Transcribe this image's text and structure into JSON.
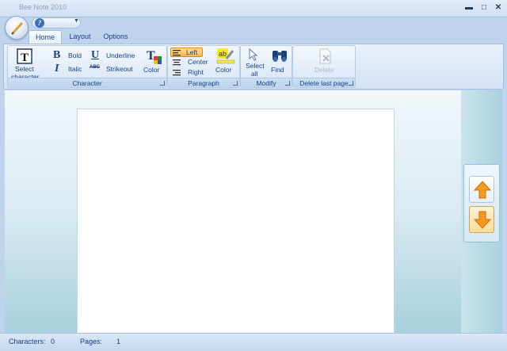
{
  "window": {
    "title": "Bee Note 2010"
  },
  "window_controls": {
    "minimize": "▬",
    "maximize": "□",
    "close": "✕"
  },
  "tabs": [
    {
      "label": "Home"
    },
    {
      "label": "Layout"
    },
    {
      "label": "Options"
    }
  ],
  "ribbon": {
    "character": {
      "group_label": "Character",
      "select_line1": "Select",
      "select_line2": "character",
      "bold": "Bold",
      "italic": "Italic",
      "underline": "Underline",
      "strikeout": "Strikeout",
      "color": "Color"
    },
    "paragraph": {
      "group_label": "Paragraph",
      "left": "Left",
      "center": "Center",
      "right": "Right",
      "color": "Color",
      "active_alignment": "left"
    },
    "modify": {
      "group_label": "Modify",
      "select_all_line1": "Select",
      "select_all_line2": "all",
      "find": "Find"
    },
    "delete_last_page": {
      "group_label": "Delete last page",
      "delete": "Delete",
      "enabled": false
    }
  },
  "status": {
    "characters_label": "Characters:",
    "characters_value": "0",
    "pages_label": "Pages:",
    "pages_value": "1"
  },
  "colors": {
    "accent": "#15428b",
    "active_tab_highlight": "#f7b64b",
    "arrow_orange": "#f59a1e"
  }
}
